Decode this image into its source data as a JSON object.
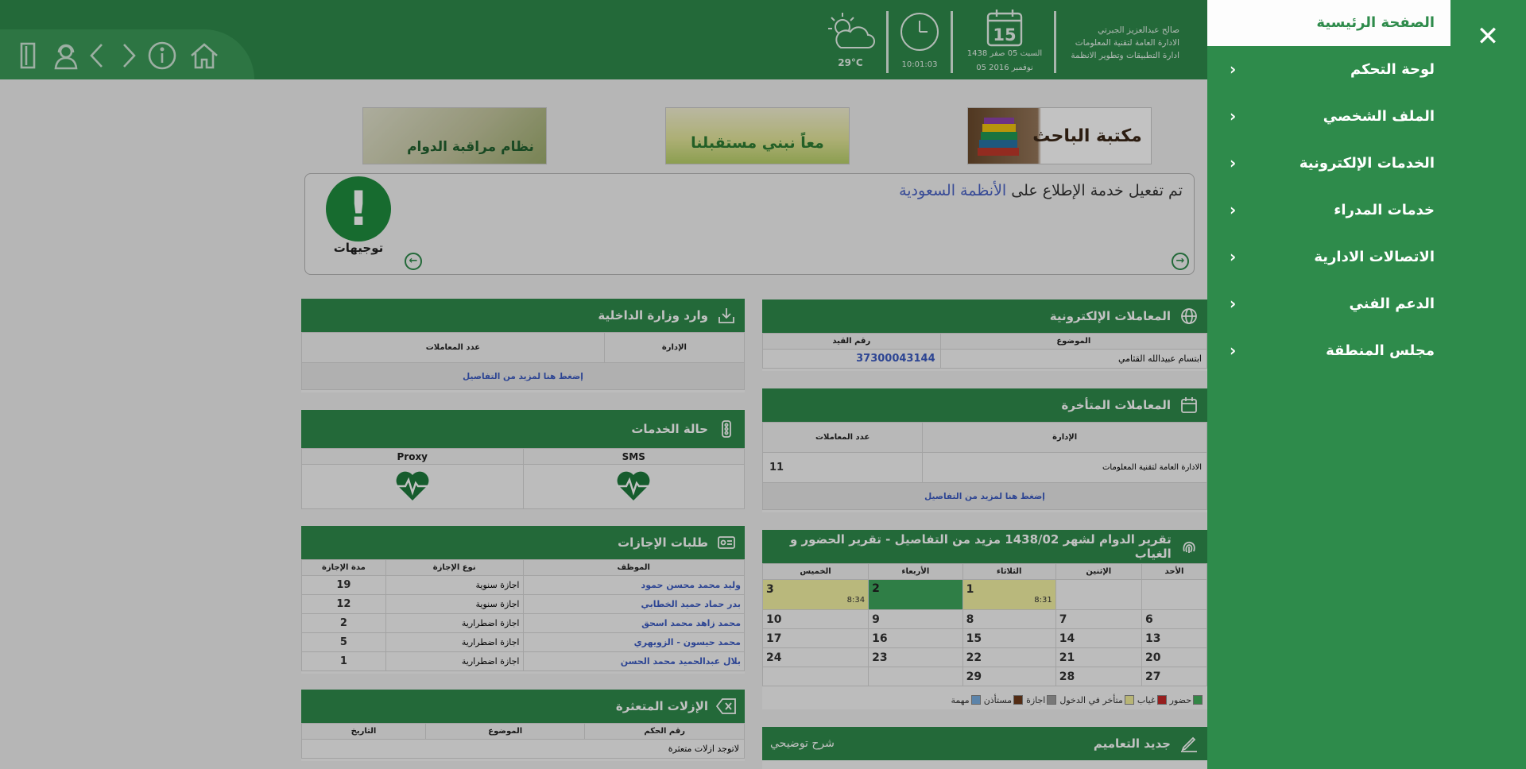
{
  "header": {
    "temperature": "29°C",
    "time": "10:01:03",
    "calendar_day": "15",
    "date_hijri": "السبت 05 صفر 1438",
    "date_gregorian": "05 نوفمبر 2016",
    "user_name": "صالح عبدالعزيز الجبرتي",
    "user_dept1": "الادارة العامة لتقنية المعلومات",
    "user_dept2": "ادارة التطبيقات وتطوير الانظمة",
    "icons": [
      "door-exit-icon",
      "support-agent-icon",
      "chevron-left-icon",
      "chevron-right-icon",
      "info-icon",
      "home-icon"
    ]
  },
  "banners": {
    "library": "مكتبة الباحث",
    "future": "معاً نبني مستقبلنا",
    "attendance": "نظام مراقبة الدوام"
  },
  "guide": {
    "text_prefix": "تم تفعيل خدمة الإطلاع على",
    "text_highlight": "الأنظمة السعودية",
    "label": "توجيهات"
  },
  "panels": {
    "etrans": {
      "title": "المعاملات الإلكترونية",
      "col_subject": "الموضوع",
      "col_ref": "رقم القيد",
      "rows": [
        {
          "subject": "ابتسام عبيدالله القثامي",
          "ref": "37300043144"
        }
      ]
    },
    "interior": {
      "title": "وارد وزارة الداخلية",
      "col_dept": "الإدارة",
      "col_count": "عدد المعاملات",
      "more": "إضغط هنا لمزيد من التفاصيل"
    },
    "late": {
      "title": "المعاملات المتأخرة",
      "col_dept": "الإدارة",
      "col_count": "عدد المعاملات",
      "rows": [
        {
          "dept": "الادارة العامة لتقنية المعلومات",
          "count": "11"
        }
      ],
      "more": "إضغط هنا لمزيد من التفاصيل"
    },
    "services": {
      "title": "حالة الخدمات",
      "col_sms": "SMS",
      "col_proxy": "Proxy"
    },
    "attendance": {
      "title": "تقرير الدوام لشهر 1438/02 مزيد من التفاصيل - تقرير الحضور و الغياب",
      "days": [
        "الأحد",
        "الإثنين",
        "الثلاثاء",
        "الأربعاء",
        "الخميس"
      ],
      "week1": [
        {
          "day": "",
          "time": "",
          "status": "empty"
        },
        {
          "day": "",
          "time": "",
          "status": "empty"
        },
        {
          "day": "1",
          "time": "8:31",
          "status": "yellow"
        },
        {
          "day": "2",
          "time": "",
          "status": "green"
        },
        {
          "day": "3",
          "time": "8:34",
          "status": "yellow"
        }
      ],
      "weeks": [
        [
          "6",
          "7",
          "8",
          "9",
          "10"
        ],
        [
          "13",
          "14",
          "15",
          "16",
          "17"
        ],
        [
          "20",
          "21",
          "22",
          "23",
          "24"
        ],
        [
          "27",
          "28",
          "29",
          "",
          ""
        ]
      ],
      "legend": [
        {
          "label": "حضور",
          "color": "#43b05c"
        },
        {
          "label": "غياب",
          "color": "#c62828"
        },
        {
          "label": "متأخر في الدخول",
          "color": "#f2ee9a"
        },
        {
          "label": "اجازة",
          "color": "#9e9e9e"
        },
        {
          "label": "مستأذن",
          "color": "#6d3b1b"
        },
        {
          "label": "مهمة",
          "color": "#7aaee0"
        }
      ]
    },
    "leaves": {
      "title": "طلبات الإجازات",
      "col_emp": "الموظف",
      "col_type": "نوع الإجازة",
      "col_days": "مدة الإجازة",
      "rows": [
        {
          "emp": "وليد محمد محسن حمود",
          "type": "اجازة سنوية",
          "days": "19"
        },
        {
          "emp": "بدر حماد حميد الخطابي",
          "type": "اجازة سنوية",
          "days": "12"
        },
        {
          "emp": "محمد زاهد محمد اسحق",
          "type": "اجازة اضطرارية",
          "days": "2"
        },
        {
          "emp": "محمد حيسون - الزويهري",
          "type": "اجازة اضطرارية",
          "days": "5"
        },
        {
          "emp": "بلال عبدالحميد محمد الحسن",
          "type": "اجازة اضطرارية",
          "days": "1"
        }
      ]
    },
    "removals": {
      "title": "الإزلات المتعثرة",
      "col_ruling": "رقم الحكم",
      "col_subject": "الموضوع",
      "col_date": "التاريخ",
      "empty": "لاتوجد ازلات متعثرة"
    },
    "circulars": {
      "title": "جديد التعاميم",
      "aside": "شرح توضيحي"
    }
  },
  "sidebar": {
    "home": "الصفحة الرئيسية",
    "items": [
      "لوحة التحكم",
      "الملف الشخصي",
      "الخدمات الإلكترونية",
      "خدمات المدراء",
      "الاتصالات الادارية",
      "الدعم الفني",
      "مجلس المنطقة"
    ]
  },
  "colors": {
    "brand_green": "#2e8b4b",
    "link_blue": "#3c5bc2"
  }
}
